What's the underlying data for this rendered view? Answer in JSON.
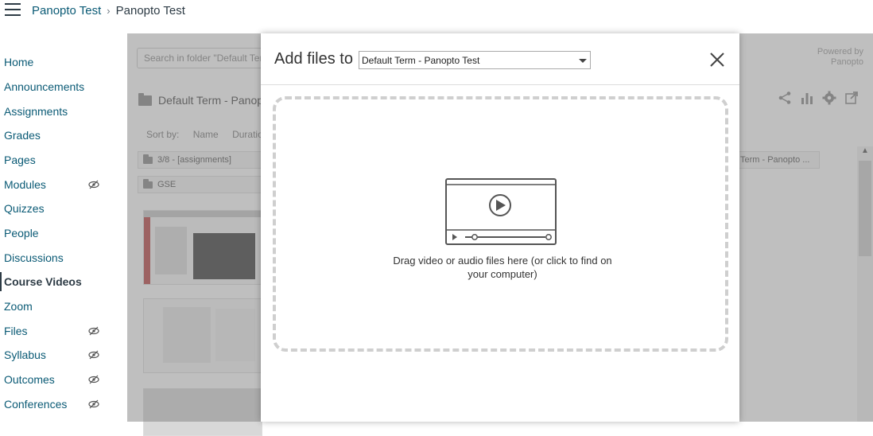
{
  "breadcrumb": {
    "course": "Panopto Test",
    "separator": "›",
    "current": "Panopto Test"
  },
  "sidebar": {
    "items": [
      {
        "label": "Home",
        "hidden": false,
        "active": false
      },
      {
        "label": "Announcements",
        "hidden": false,
        "active": false
      },
      {
        "label": "Assignments",
        "hidden": false,
        "active": false
      },
      {
        "label": "Grades",
        "hidden": false,
        "active": false
      },
      {
        "label": "Pages",
        "hidden": false,
        "active": false
      },
      {
        "label": "Modules",
        "hidden": true,
        "active": false
      },
      {
        "label": "Quizzes",
        "hidden": false,
        "active": false
      },
      {
        "label": "People",
        "hidden": false,
        "active": false
      },
      {
        "label": "Discussions",
        "hidden": false,
        "active": false
      },
      {
        "label": "Course Videos",
        "hidden": false,
        "active": true
      },
      {
        "label": "Zoom",
        "hidden": false,
        "active": false
      },
      {
        "label": "Files",
        "hidden": true,
        "active": false
      },
      {
        "label": "Syllabus",
        "hidden": true,
        "active": false
      },
      {
        "label": "Outcomes",
        "hidden": true,
        "active": false
      },
      {
        "label": "Conferences",
        "hidden": true,
        "active": false
      }
    ]
  },
  "panopto": {
    "search_placeholder": "Search in folder \"Default Term",
    "powered_by_line1": "Powered by",
    "powered_by_line2": "Panopto",
    "folder_title": "Default Term - Panopto",
    "sort_label": "Sort by:",
    "sort_name": "Name",
    "sort_duration": "Duration",
    "subfolders": [
      "3/8 - [assignments]",
      "GSE"
    ],
    "term_chip": "Term - Panopto ..."
  },
  "modal": {
    "title": "Add files to",
    "selected_folder": "Default Term - Panopto Test",
    "drop_text": "Drag video or audio files here (or click to find on your computer)"
  },
  "colors": {
    "link": "#0a5a75",
    "overlay": "rgba(128,128,128,0.5)",
    "dash": "#cfcfcf"
  }
}
